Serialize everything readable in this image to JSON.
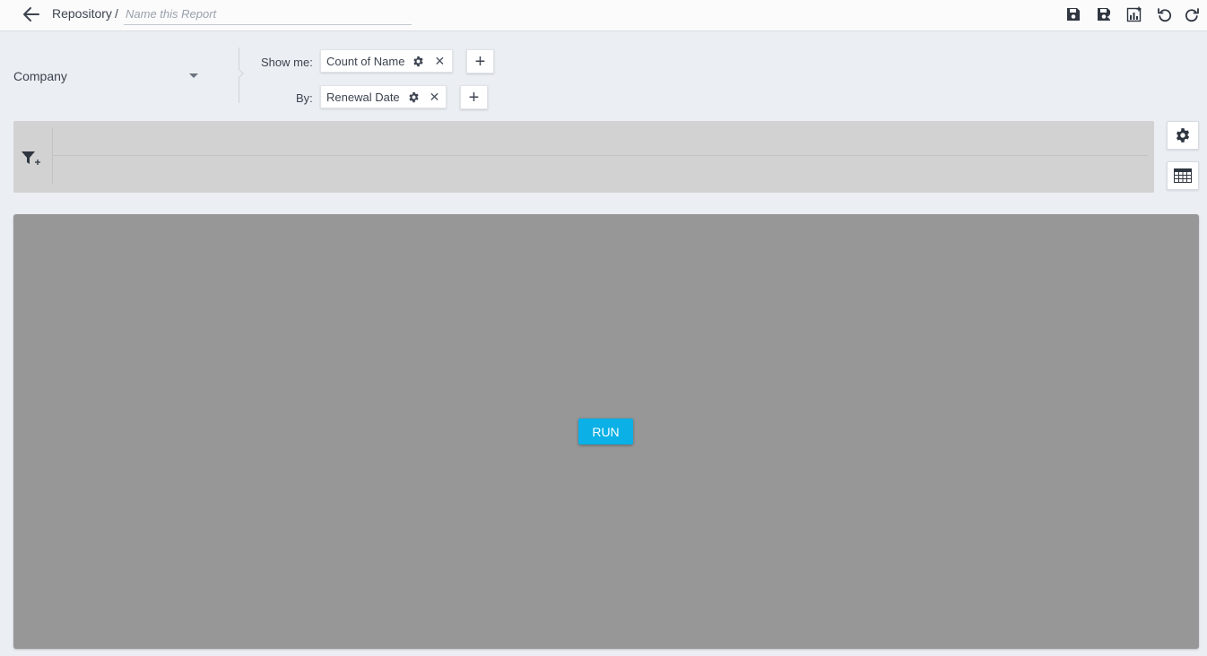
{
  "header": {
    "breadcrumb": "Repository",
    "separator": "/",
    "report_name_value": "",
    "report_name_placeholder": "Name this Report",
    "toolbar_icons": [
      "save-icon",
      "save-as-icon",
      "add-chart-icon",
      "undo-icon",
      "redo-icon"
    ]
  },
  "config": {
    "object_label": "Company",
    "show_me_label": "Show me:",
    "show_me_chips": [
      {
        "label": "Count of Name"
      }
    ],
    "by_label": "By:",
    "by_chips": [
      {
        "label": "Renewal Date"
      }
    ],
    "add_label": "+"
  },
  "filter": {
    "icon": "add-filter-icon"
  },
  "side_buttons": [
    "settings-icon",
    "table-view-icon"
  ],
  "canvas": {
    "run_label": "RUN"
  },
  "colors": {
    "accent": "#0ab0e6",
    "canvas_bg": "#979797",
    "filter_bg": "#d2d2d2",
    "page_bg": "#ebeef2"
  }
}
